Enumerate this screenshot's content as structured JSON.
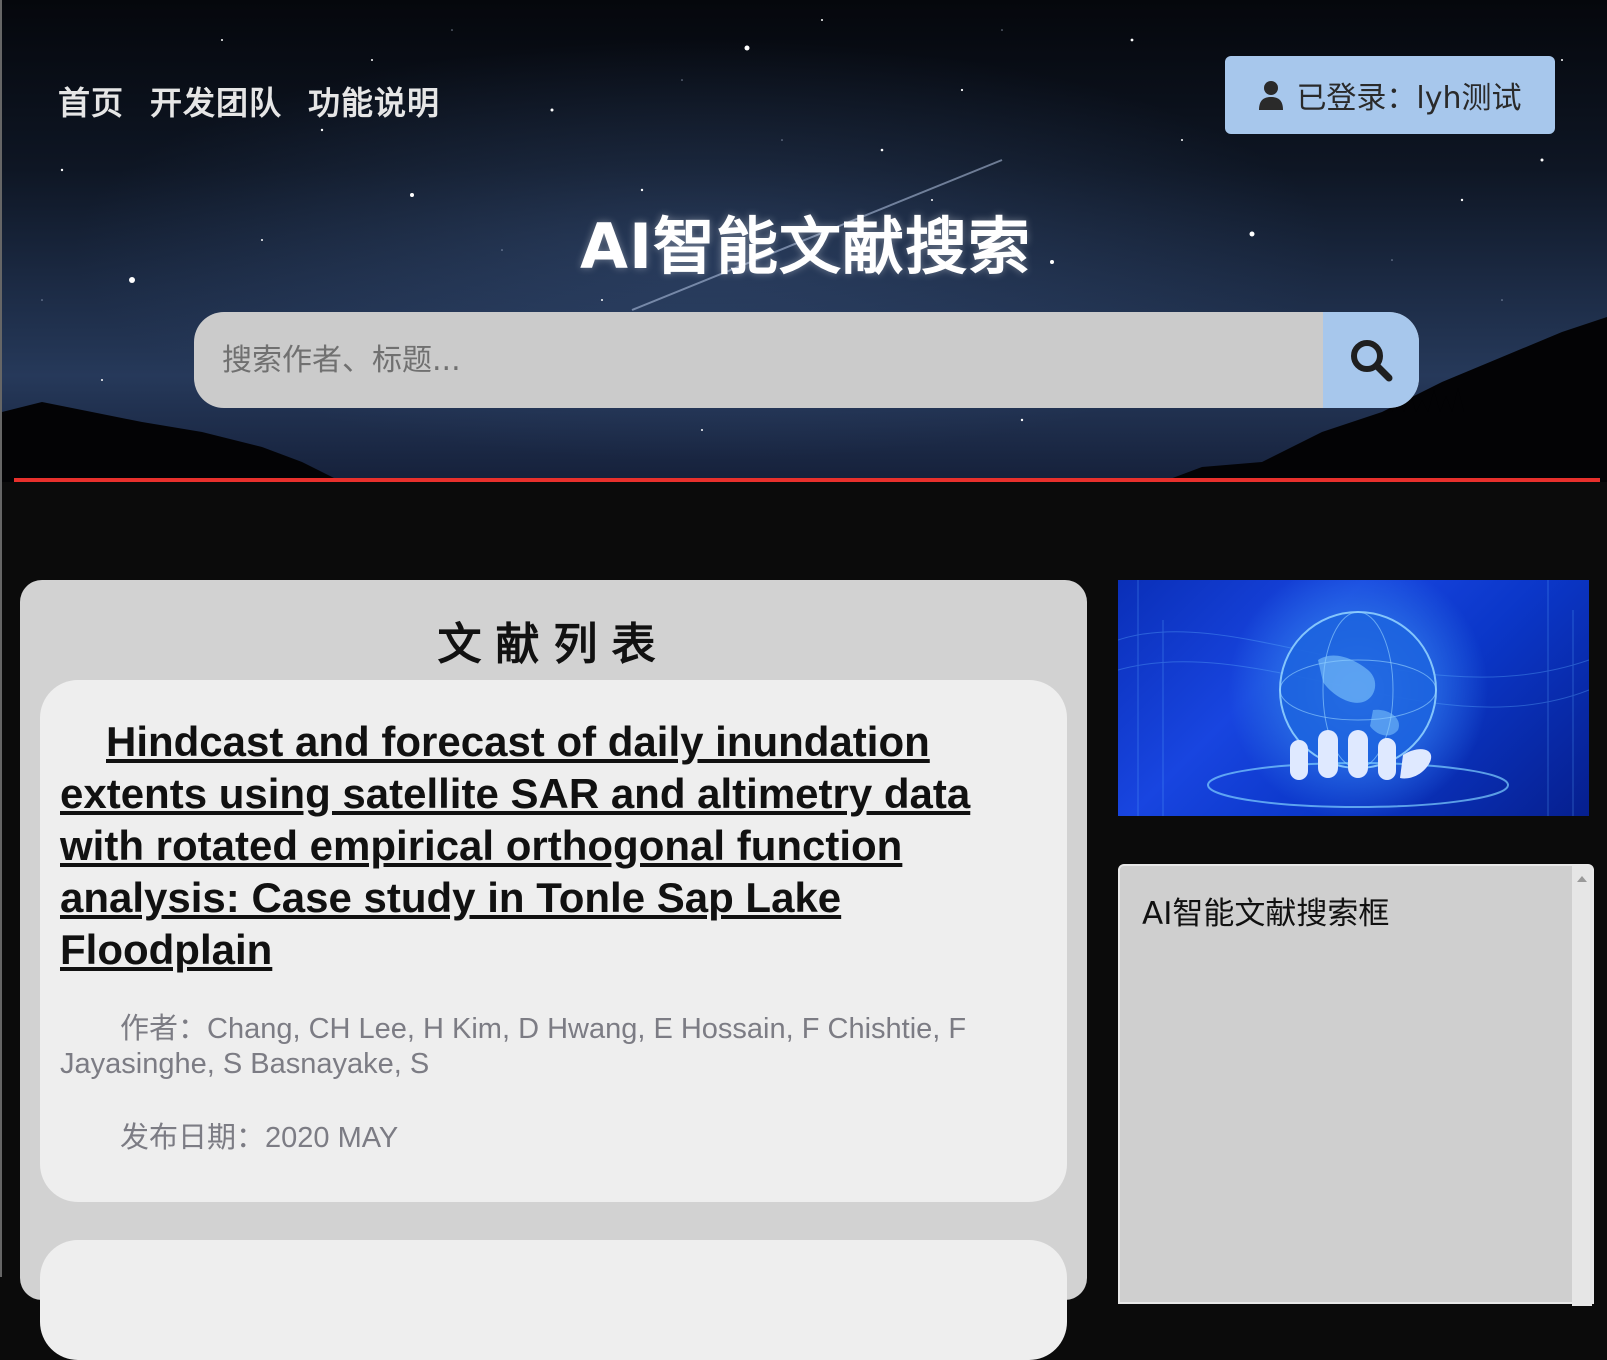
{
  "nav": {
    "home": "首页",
    "team": "开发团队",
    "features": "功能说明"
  },
  "user": {
    "login_label": "已登录：lyh测试",
    "icon": "user-icon"
  },
  "site": {
    "title": "AI智能文献搜索"
  },
  "search": {
    "placeholder": "搜索作者、标题...",
    "icon": "search-icon"
  },
  "list": {
    "title": "文献列表",
    "items": [
      {
        "title": "Hindcast and forecast of daily inundation extents using satellite SAR and altimetry data with rotated empirical orthogonal function analysis: Case study in Tonle Sap Lake Floodplain",
        "authors": "作者：Chang, CH Lee, H Kim, D Hwang, E Hossain, F Chishtie, F Jayasinghe, S Basnayake, S",
        "date": "发布日期：2020 MAY"
      }
    ]
  },
  "ai_box": {
    "text": "AI智能文献搜索框"
  },
  "colors": {
    "accent_blue": "#a7c7ec",
    "divider_red": "#e8302c",
    "panel_gray": "#d2d2d2",
    "card_bg": "#eeeeee"
  }
}
